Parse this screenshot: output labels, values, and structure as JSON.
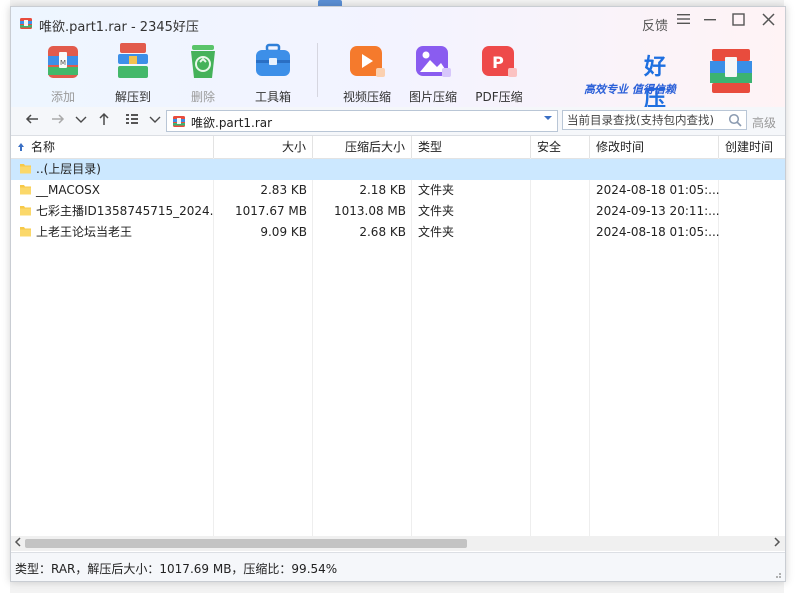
{
  "window": {
    "title": "唯欲.part1.rar - 2345好压",
    "feedback_label": "反馈"
  },
  "toolbar": [
    {
      "label": "添加",
      "icon": "add-icon",
      "enabled": false
    },
    {
      "label": "解压到",
      "icon": "extract-icon",
      "enabled": true
    },
    {
      "label": "删除",
      "icon": "delete-icon",
      "enabled": false
    },
    {
      "label": "工具箱",
      "icon": "toolbox-icon",
      "enabled": true
    },
    {
      "label": "视频压缩",
      "icon": "video-compress-icon",
      "enabled": true
    },
    {
      "label": "图片压缩",
      "icon": "image-compress-icon",
      "enabled": true
    },
    {
      "label": "PDF压缩",
      "icon": "pdf-compress-icon",
      "enabled": true
    }
  ],
  "brand": {
    "name": "好压",
    "slogan": "高效专业 值得信赖"
  },
  "nav": {
    "path": "唯欲.part1.rar",
    "search_placeholder": "当前目录查找(支持包内查找)",
    "advanced_label": "高级"
  },
  "columns": [
    "名称",
    "大小",
    "压缩后大小",
    "类型",
    "安全",
    "修改时间",
    "创建时间"
  ],
  "rows": [
    {
      "name": "..(上层目录)",
      "size": "",
      "packed": "",
      "type": "",
      "safe": "",
      "modified": "",
      "created": "",
      "selected": true
    },
    {
      "name": "__MACOSX",
      "size": "2.83 KB",
      "packed": "2.18 KB",
      "type": "文件夹",
      "safe": "",
      "modified": "2024-08-18 01:05:...",
      "created": ""
    },
    {
      "name": "七彩主播ID1358745715_2024...",
      "size": "1017.67 MB",
      "packed": "1013.08 MB",
      "type": "文件夹",
      "safe": "",
      "modified": "2024-09-13 20:11:...",
      "created": ""
    },
    {
      "name": "上老王论坛当老王",
      "size": "9.09 KB",
      "packed": "2.68 KB",
      "type": "文件夹",
      "safe": "",
      "modified": "2024-08-18 01:05:...",
      "created": ""
    }
  ],
  "status": "类型：RAR，解压后大小：1017.69 MB，压缩比：99.54%",
  "colors": {
    "accent": "#1e6fe0",
    "selection": "#cce8ff",
    "folder": "#f7c948"
  }
}
